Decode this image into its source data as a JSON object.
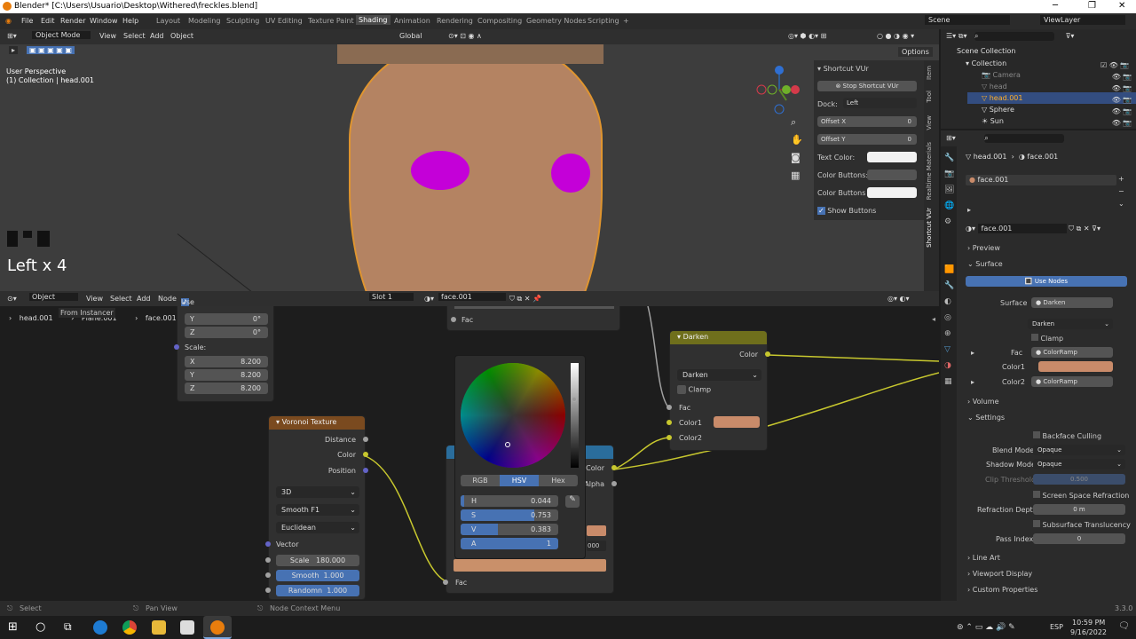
{
  "titlebar": {
    "title": "Blender* [C:\\Users\\Usuario\\Desktop\\Withered\\freckles.blend]"
  },
  "menu": [
    "File",
    "Edit",
    "Render",
    "Window",
    "Help"
  ],
  "workspaces": [
    "Layout",
    "Modeling",
    "Sculpting",
    "UV Editing",
    "Texture Paint",
    "Shading",
    "Animation",
    "Rendering",
    "Compositing",
    "Geometry Nodes",
    "Scripting"
  ],
  "active_workspace": "Shading",
  "scene": "Scene",
  "view_layer": "ViewLayer",
  "viewport": {
    "mode": "Object Mode",
    "menus": [
      "View",
      "Select",
      "Add",
      "Object"
    ],
    "orientation": "Global",
    "perspective": "User Perspective",
    "collection_info": "(1) Collection | head.001",
    "overlay_text": "Left x 4",
    "options": "Options"
  },
  "npanel": {
    "title": "Shortcut VUr",
    "stop_button": "Stop Shortcut VUr",
    "dock_label": "Dock:",
    "dock_value": "Left",
    "offset_x_label": "Offset X",
    "offset_x": "0",
    "offset_y_label": "Offset Y",
    "offset_y": "0",
    "text_color": "Text Color:",
    "color_buttons": "Color Buttons:",
    "color_buttons_a": "Color Buttons a...",
    "show_buttons": "Show Buttons",
    "tabs": [
      "Item",
      "Tool",
      "View",
      "Realtime Materials",
      "Shortcut VUr"
    ]
  },
  "node_editor": {
    "object": "Object",
    "menus": [
      "View",
      "Select",
      "Add",
      "Node"
    ],
    "use_nodes": "Use Nodes",
    "slot": "Slot 1",
    "material": "face.001",
    "breadcrumb": [
      "head.001",
      "Plane.001",
      "face.001"
    ],
    "from_instancer": "From Instancer"
  },
  "mapping_node": {
    "y_label": "Y",
    "y_val": "0°",
    "z_label": "Z",
    "z_val": "0°",
    "scale_label": "Scale:",
    "sx_label": "X",
    "sx": "8.200",
    "sy_label": "Y",
    "sy": "8.200",
    "sz_label": "Z",
    "sz": "8.200"
  },
  "voronoi": {
    "title": "Voronoi Texture",
    "outputs": [
      "Distance",
      "Color",
      "Position"
    ],
    "dim": "3D",
    "feature": "Smooth F1",
    "metric": "Euclidean",
    "vector": "Vector",
    "scale_label": "Scale",
    "scale": "180.000",
    "smooth_label": "Smooth",
    "smooth": "1.000",
    "random_label": "Randomn",
    "random": "1.000"
  },
  "fac_node": {
    "fac": "Fac"
  },
  "color_picker": {
    "modes": [
      "RGB",
      "HSV",
      "Hex"
    ],
    "active_mode": "HSV",
    "h_label": "H",
    "h": "0.044",
    "s_label": "S",
    "s": "0.753",
    "v_label": "V",
    "v": "0.383",
    "a_label": "A",
    "a": "1",
    "swatch": "#c9906a"
  },
  "mix_node": {
    "color": "Color",
    "alpha": "Alpha",
    "fac": "Fac",
    "partial": "000"
  },
  "darken_node": {
    "title": "Darken",
    "color_out": "Color",
    "mode": "Darken",
    "clamp": "Clamp",
    "fac": "Fac",
    "color1": "Color1",
    "color2": "Color2",
    "color1_value": "#c98b6a"
  },
  "outliner": {
    "root": "Scene Collection",
    "collection": "Collection",
    "items": [
      "Camera",
      "head",
      "head.001",
      "Sphere",
      "Sun"
    ],
    "selected": "head.001"
  },
  "properties": {
    "object": "head.001",
    "material": "face.001",
    "slot": "face.001",
    "preview": "Preview",
    "surface_section": "Surface",
    "use_nodes": "Use Nodes",
    "surface_label": "Surface",
    "surface_value": "Darken",
    "blend": "Darken",
    "clamp": "Clamp",
    "fac_label": "Fac",
    "fac_value": "ColorRamp",
    "color1_label": "Color1",
    "color2_label": "Color2",
    "color2_value": "ColorRamp",
    "volume": "Volume",
    "settings": "Settings",
    "backface": "Backface Culling",
    "blend_mode_label": "Blend Mode",
    "blend_mode": "Opaque",
    "shadow_mode_label": "Shadow Mode",
    "shadow_mode": "Opaque",
    "clip_label": "Clip Threshold",
    "clip": "0.500",
    "ssr": "Screen Space Refraction",
    "refraction_label": "Refraction Depth",
    "refraction": "0 m",
    "subsurface": "Subsurface Translucency",
    "pass_label": "Pass Index",
    "pass": "0",
    "line_art": "Line Art",
    "viewport_display": "Viewport Display",
    "custom_props": "Custom Properties"
  },
  "status": {
    "select": "Select",
    "pan": "Pan View",
    "context": "Node Context Menu",
    "version": "3.3.0"
  },
  "taskbar": {
    "time": "10:59 PM",
    "date": "9/16/2022",
    "lang": "ESP"
  }
}
